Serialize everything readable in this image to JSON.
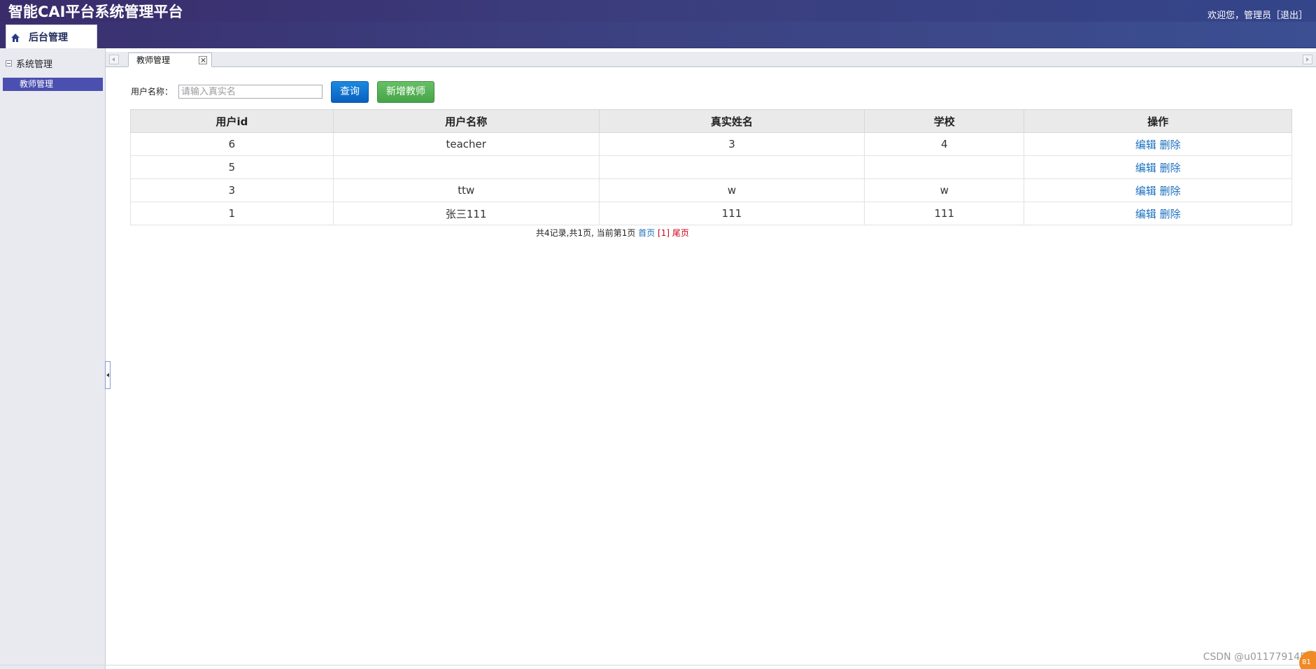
{
  "header": {
    "app_title": "智能CAI平台系统管理平台",
    "welcome": "欢迎您，管理员",
    "logout": "［退出］",
    "header_bg": "#3b3e7e"
  },
  "top_tab": {
    "label": "后台管理",
    "icon": "home-icon"
  },
  "sidebar": {
    "section": "系统管理",
    "items": [
      {
        "label": "教师管理",
        "active": true
      }
    ],
    "active_color": "#4b4fb0"
  },
  "content_tabs": [
    {
      "label": "教师管理"
    }
  ],
  "search": {
    "label": "用户名称：",
    "placeholder": "请输入真实名",
    "value": "",
    "query_button": "查询",
    "add_button": "新增教师"
  },
  "table": {
    "columns": [
      "用户id",
      "用户名称",
      "真实姓名",
      "学校",
      "操作"
    ],
    "rows": [
      {
        "id": "6",
        "username": "teacher",
        "realname": "3",
        "school": "4"
      },
      {
        "id": "5",
        "username": "",
        "realname": "",
        "school": ""
      },
      {
        "id": "3",
        "username": "ttw",
        "realname": "w",
        "school": "w"
      },
      {
        "id": "1",
        "username": "张三111",
        "realname": "111",
        "school": "111"
      }
    ],
    "edit_label": "编辑",
    "delete_label": "删除",
    "link_color": "#1a6fbf"
  },
  "pager": {
    "summary": "共4记录,共1页, 当前第1页",
    "first": "首页",
    "current": "[1]",
    "last": "尾页"
  },
  "footer": {
    "watermark": "CSDN @u011779145",
    "badge": "81"
  }
}
